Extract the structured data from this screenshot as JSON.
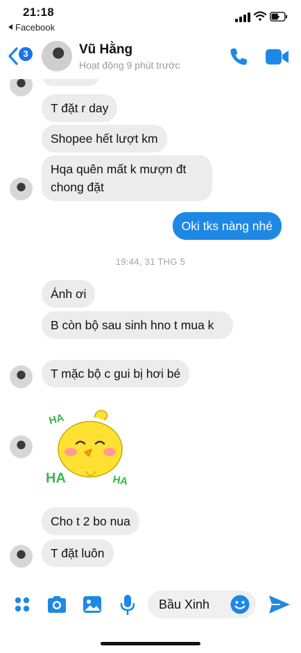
{
  "status_bar": {
    "time": "21:18",
    "back_app": "Facebook"
  },
  "header": {
    "unread_count": "3",
    "contact_name": "Vũ Hằng",
    "contact_status": "Hoạt động 9 phút trước",
    "icons": [
      "back-chevron-icon",
      "phone-icon",
      "video-camera-icon"
    ]
  },
  "messages": [
    {
      "from": "them",
      "text": "T đặt r day"
    },
    {
      "from": "them",
      "text": "Shopee hết lượt km"
    },
    {
      "from": "them",
      "text": "Hqa quên mất k mượn đt chong đặt"
    },
    {
      "from": "me",
      "text": "Oki tks nàng nhé"
    },
    {
      "type": "timestamp",
      "text": "19:44, 31 THG 5"
    },
    {
      "from": "them",
      "text": "Ánh ơi"
    },
    {
      "from": "them",
      "text": "B còn bộ sau sinh hno t mua k"
    },
    {
      "from": "them",
      "text": "T mặc bộ c gui bị hơi bé"
    },
    {
      "from": "them",
      "type": "sticker",
      "sticker_text": [
        "HA",
        "HA",
        "HA"
      ]
    },
    {
      "from": "them",
      "text": "Cho t 2 bo nua"
    },
    {
      "from": "them",
      "text": "T đặt luôn"
    }
  ],
  "composer": {
    "input_value": "Bầu Xinh",
    "icons": [
      "apps-grid-icon",
      "camera-icon",
      "photo-icon",
      "microphone-icon",
      "emoji-icon",
      "send-icon"
    ]
  },
  "colors": {
    "accent": "#1e88e5",
    "incoming_bubble": "#ececec",
    "timestamp": "#a3a3a3"
  }
}
